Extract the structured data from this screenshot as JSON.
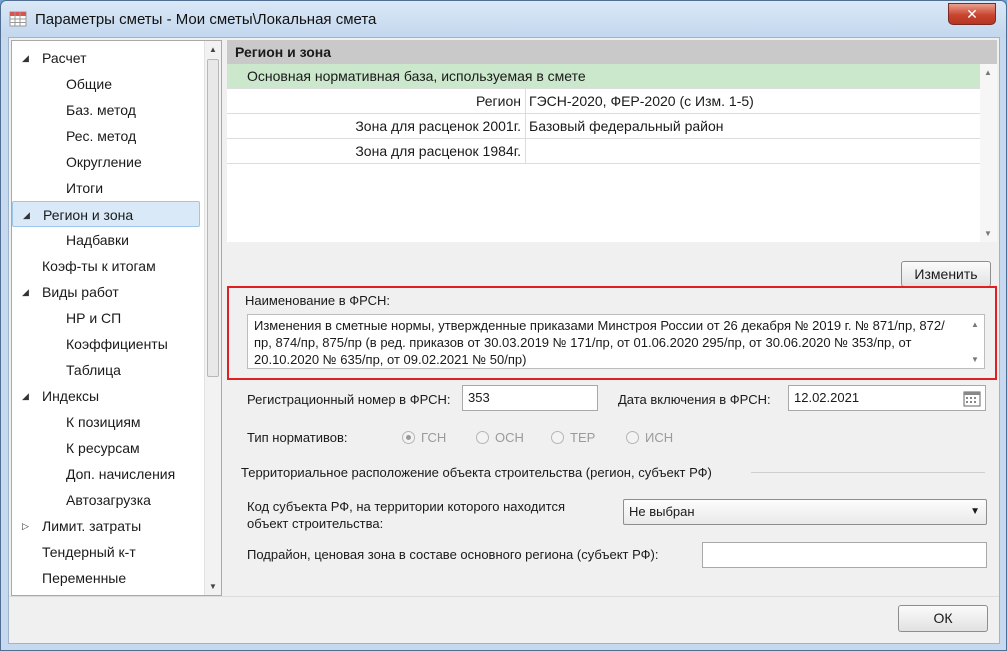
{
  "window": {
    "title": "Параметры сметы - Мои сметы\\Локальная смета",
    "close_label": "✕"
  },
  "tree": {
    "items": [
      {
        "label": "Расчет",
        "arrow": "◢"
      },
      {
        "label": "Общие"
      },
      {
        "label": "Баз. метод"
      },
      {
        "label": "Рес. метод"
      },
      {
        "label": "Округление"
      },
      {
        "label": "Итоги"
      },
      {
        "label": "Регион и зона",
        "arrow": "◢",
        "selected": true
      },
      {
        "label": "Надбавки"
      },
      {
        "label": "Коэф-ты к итогам"
      },
      {
        "label": "Виды работ",
        "arrow": "◢"
      },
      {
        "label": "НР и СП"
      },
      {
        "label": "Коэффициенты"
      },
      {
        "label": "Таблица"
      },
      {
        "label": "Индексы",
        "arrow": "◢"
      },
      {
        "label": "К позициям"
      },
      {
        "label": "К ресурсам"
      },
      {
        "label": "Доп. начисления"
      },
      {
        "label": "Автозагрузка"
      },
      {
        "label": "Лимит. затраты",
        "arrow": "▷"
      },
      {
        "label": "Тендерный к-т"
      },
      {
        "label": "Переменные"
      }
    ]
  },
  "panel": {
    "header": "Регион и зона",
    "grid": {
      "base_label": "Основная нормативная база, используемая в смете",
      "rows": [
        {
          "label": "Регион",
          "value": "ГЭСН-2020, ФЕР-2020 (с Изм. 1-5)"
        },
        {
          "label": "Зона для расценок 2001г.",
          "value": "Базовый федеральный район"
        },
        {
          "label": "Зона для расценок 1984г.",
          "value": ""
        }
      ]
    },
    "change_button": "Изменить",
    "frsn": {
      "label": "Наименование в ФРСН:",
      "text": "Изменения в сметные нормы, утвержденные приказами Минстроя России от 26 декабря № 2019 г. № 871/пр, 872/пр, 874/пр, 875/пр (в ред. приказов от 30.03.2019 № 171/пр, от 01.06.2020 295/пр, от 30.06.2020 № 353/пр, от 20.10.2020 № 635/пр, от 09.02.2021 № 50/пр)"
    },
    "reg_number": {
      "label": "Регистрационный номер в ФРСН:",
      "value": "353"
    },
    "inclusion_date": {
      "label": "Дата включения в ФРСН:",
      "value": "12.02.2021"
    },
    "norm_type": {
      "label": "Тип нормативов:",
      "options": [
        {
          "label": "ГСН",
          "selected": true
        },
        {
          "label": "ОСН",
          "selected": false
        },
        {
          "label": "ТЕР",
          "selected": false
        },
        {
          "label": "ИСН",
          "selected": false
        }
      ]
    },
    "territory_heading": "Территориальное расположение объекта строительства (регион, субъект РФ)",
    "subject_code": {
      "label_line1": "Код субъекта РФ, на территории которого находится",
      "label_line2": "объект строительства:",
      "value": "Не выбран"
    },
    "subregion": {
      "label": "Подрайон, ценовая зона в составе основного региона (субъект РФ):",
      "value": ""
    }
  },
  "footer": {
    "ok_label": "ОК"
  }
}
